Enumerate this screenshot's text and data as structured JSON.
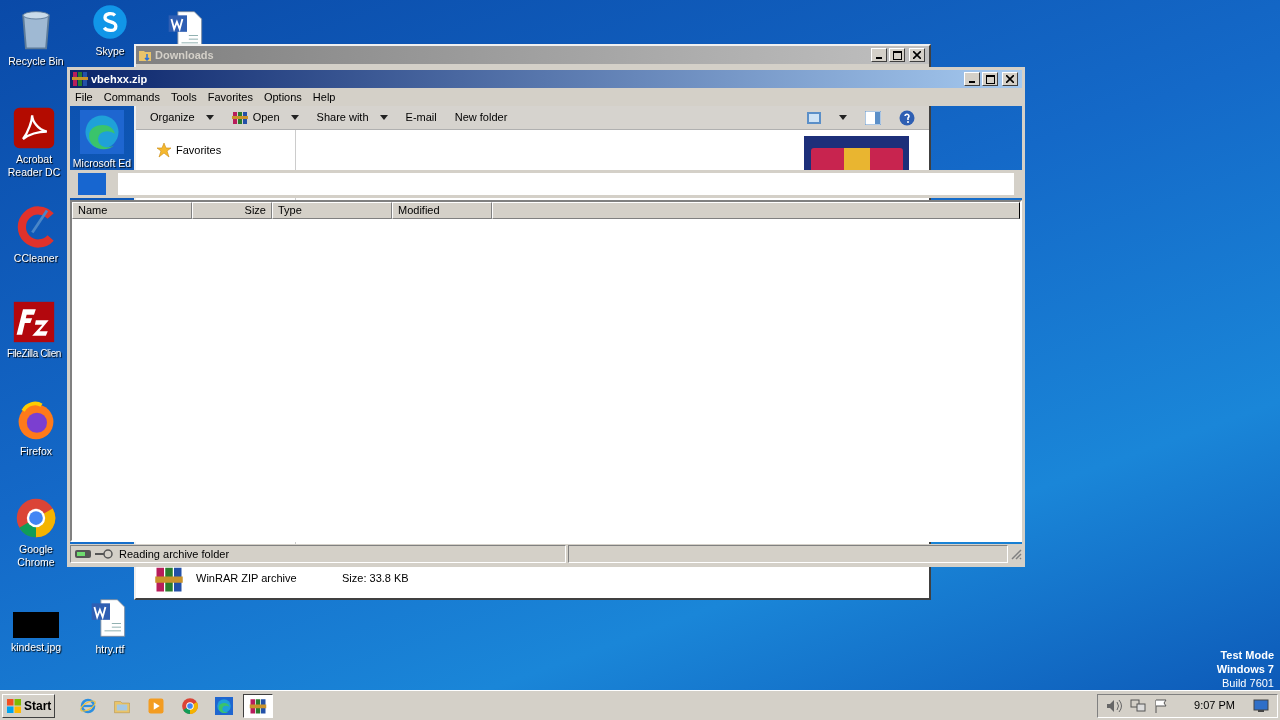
{
  "desktop_icons": [
    {
      "kind": "recycle-bin",
      "label": "Recycle Bin"
    },
    {
      "kind": "acrobat",
      "label": "Acrobat Reader DC"
    },
    {
      "kind": "ccleaner",
      "label": "CCleaner"
    },
    {
      "kind": "filezilla",
      "label": "FileZilla Clien"
    },
    {
      "kind": "firefox",
      "label": "Firefox"
    },
    {
      "kind": "chrome",
      "label": "Google Chrome"
    },
    {
      "kind": "image-file",
      "label": "kindest.jpg"
    },
    {
      "kind": "skype",
      "label": "Skype"
    },
    {
      "kind": "edge",
      "label": "Microsoft Ed"
    },
    {
      "kind": "word-document",
      "label": "htry.rtf"
    },
    {
      "kind": "word-document"
    }
  ],
  "downloads_window": {
    "title": "Downloads",
    "active": false,
    "toolbar": [
      {
        "label": "Organize",
        "kind": "plain",
        "dropdown": true
      },
      {
        "label": "Open",
        "kind": "with-icon",
        "dropdown": true
      },
      {
        "label": "Share with",
        "kind": "plain",
        "dropdown": true
      },
      {
        "label": "E-mail",
        "kind": "plain",
        "dropdown": false
      },
      {
        "label": "New folder",
        "kind": "plain",
        "dropdown": false
      }
    ],
    "nav": [
      {
        "label": "Favorites"
      }
    ],
    "details": {
      "type": "WinRAR ZIP archive",
      "size": "Size: 33.8 KB"
    }
  },
  "archive_window": {
    "title": "vbehxx.zip",
    "active": true,
    "menu": [
      "File",
      "Commands",
      "Tools",
      "Favorites",
      "Options",
      "Help"
    ],
    "columns": [
      {
        "label": "Name"
      },
      {
        "label": "Size"
      },
      {
        "label": "Type"
      },
      {
        "label": "Modified"
      }
    ],
    "status": "Reading archive folder"
  },
  "taskbar": {
    "start": "Start",
    "apps": [
      {
        "kind": "ie",
        "selected": false
      },
      {
        "kind": "explorer",
        "selected": false
      },
      {
        "kind": "media-player",
        "selected": false
      },
      {
        "kind": "chrome",
        "selected": false
      },
      {
        "kind": "edge",
        "selected": false
      },
      {
        "kind": "winrar",
        "selected": true
      }
    ],
    "clock": "9:07 PM"
  },
  "system_notice": [
    {
      "text": "Test Mode",
      "bold": true
    },
    {
      "text": "Windows 7",
      "bold": true
    },
    {
      "text": "Build 7601",
      "bold": false
    }
  ]
}
